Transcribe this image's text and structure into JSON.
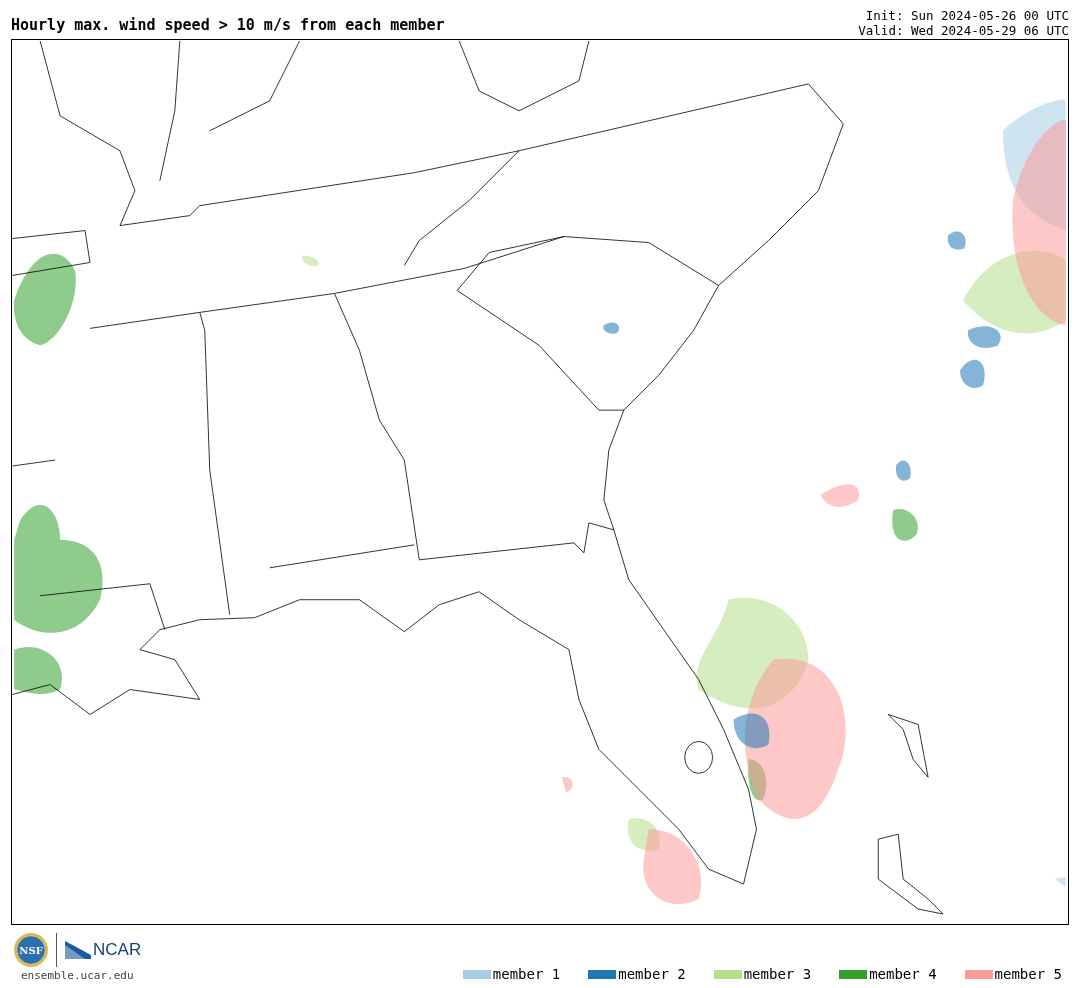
{
  "title": "Hourly max. wind speed > 10 m/s from each member",
  "init": "Init: Sun 2024-05-26 00 UTC",
  "valid": "Valid: Wed 2024-05-29 06 UTC",
  "logos": {
    "nsf": "NSF",
    "ncar": "NCAR"
  },
  "site": "ensemble.ucar.edu",
  "legend": [
    {
      "label": "member 1",
      "color": "#a6cee3"
    },
    {
      "label": "member 2",
      "color": "#1f78b4"
    },
    {
      "label": "member 3",
      "color": "#b2df8a"
    },
    {
      "label": "member 4",
      "color": "#33a02c"
    },
    {
      "label": "member 5",
      "color": "#fb9a99"
    }
  ]
}
